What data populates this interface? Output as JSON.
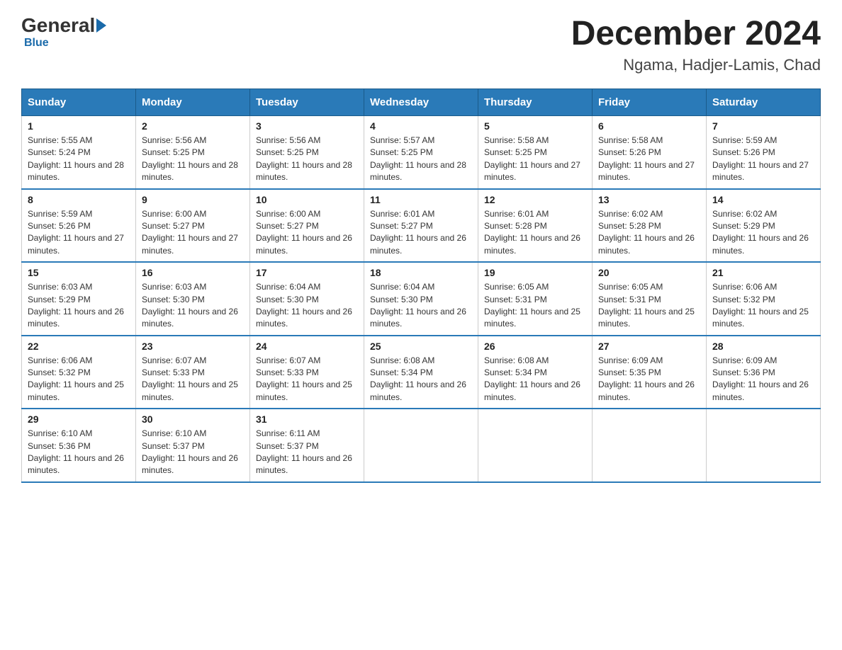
{
  "logo": {
    "general": "General",
    "blue": "Blue"
  },
  "title": "December 2024",
  "subtitle": "Ngama, Hadjer-Lamis, Chad",
  "days_of_week": [
    "Sunday",
    "Monday",
    "Tuesday",
    "Wednesday",
    "Thursday",
    "Friday",
    "Saturday"
  ],
  "weeks": [
    [
      {
        "day": "1",
        "sunrise": "5:55 AM",
        "sunset": "5:24 PM",
        "daylight": "11 hours and 28 minutes."
      },
      {
        "day": "2",
        "sunrise": "5:56 AM",
        "sunset": "5:25 PM",
        "daylight": "11 hours and 28 minutes."
      },
      {
        "day": "3",
        "sunrise": "5:56 AM",
        "sunset": "5:25 PM",
        "daylight": "11 hours and 28 minutes."
      },
      {
        "day": "4",
        "sunrise": "5:57 AM",
        "sunset": "5:25 PM",
        "daylight": "11 hours and 28 minutes."
      },
      {
        "day": "5",
        "sunrise": "5:58 AM",
        "sunset": "5:25 PM",
        "daylight": "11 hours and 27 minutes."
      },
      {
        "day": "6",
        "sunrise": "5:58 AM",
        "sunset": "5:26 PM",
        "daylight": "11 hours and 27 minutes."
      },
      {
        "day": "7",
        "sunrise": "5:59 AM",
        "sunset": "5:26 PM",
        "daylight": "11 hours and 27 minutes."
      }
    ],
    [
      {
        "day": "8",
        "sunrise": "5:59 AM",
        "sunset": "5:26 PM",
        "daylight": "11 hours and 27 minutes."
      },
      {
        "day": "9",
        "sunrise": "6:00 AM",
        "sunset": "5:27 PM",
        "daylight": "11 hours and 27 minutes."
      },
      {
        "day": "10",
        "sunrise": "6:00 AM",
        "sunset": "5:27 PM",
        "daylight": "11 hours and 26 minutes."
      },
      {
        "day": "11",
        "sunrise": "6:01 AM",
        "sunset": "5:27 PM",
        "daylight": "11 hours and 26 minutes."
      },
      {
        "day": "12",
        "sunrise": "6:01 AM",
        "sunset": "5:28 PM",
        "daylight": "11 hours and 26 minutes."
      },
      {
        "day": "13",
        "sunrise": "6:02 AM",
        "sunset": "5:28 PM",
        "daylight": "11 hours and 26 minutes."
      },
      {
        "day": "14",
        "sunrise": "6:02 AM",
        "sunset": "5:29 PM",
        "daylight": "11 hours and 26 minutes."
      }
    ],
    [
      {
        "day": "15",
        "sunrise": "6:03 AM",
        "sunset": "5:29 PM",
        "daylight": "11 hours and 26 minutes."
      },
      {
        "day": "16",
        "sunrise": "6:03 AM",
        "sunset": "5:30 PM",
        "daylight": "11 hours and 26 minutes."
      },
      {
        "day": "17",
        "sunrise": "6:04 AM",
        "sunset": "5:30 PM",
        "daylight": "11 hours and 26 minutes."
      },
      {
        "day": "18",
        "sunrise": "6:04 AM",
        "sunset": "5:30 PM",
        "daylight": "11 hours and 26 minutes."
      },
      {
        "day": "19",
        "sunrise": "6:05 AM",
        "sunset": "5:31 PM",
        "daylight": "11 hours and 25 minutes."
      },
      {
        "day": "20",
        "sunrise": "6:05 AM",
        "sunset": "5:31 PM",
        "daylight": "11 hours and 25 minutes."
      },
      {
        "day": "21",
        "sunrise": "6:06 AM",
        "sunset": "5:32 PM",
        "daylight": "11 hours and 25 minutes."
      }
    ],
    [
      {
        "day": "22",
        "sunrise": "6:06 AM",
        "sunset": "5:32 PM",
        "daylight": "11 hours and 25 minutes."
      },
      {
        "day": "23",
        "sunrise": "6:07 AM",
        "sunset": "5:33 PM",
        "daylight": "11 hours and 25 minutes."
      },
      {
        "day": "24",
        "sunrise": "6:07 AM",
        "sunset": "5:33 PM",
        "daylight": "11 hours and 25 minutes."
      },
      {
        "day": "25",
        "sunrise": "6:08 AM",
        "sunset": "5:34 PM",
        "daylight": "11 hours and 26 minutes."
      },
      {
        "day": "26",
        "sunrise": "6:08 AM",
        "sunset": "5:34 PM",
        "daylight": "11 hours and 26 minutes."
      },
      {
        "day": "27",
        "sunrise": "6:09 AM",
        "sunset": "5:35 PM",
        "daylight": "11 hours and 26 minutes."
      },
      {
        "day": "28",
        "sunrise": "6:09 AM",
        "sunset": "5:36 PM",
        "daylight": "11 hours and 26 minutes."
      }
    ],
    [
      {
        "day": "29",
        "sunrise": "6:10 AM",
        "sunset": "5:36 PM",
        "daylight": "11 hours and 26 minutes."
      },
      {
        "day": "30",
        "sunrise": "6:10 AM",
        "sunset": "5:37 PM",
        "daylight": "11 hours and 26 minutes."
      },
      {
        "day": "31",
        "sunrise": "6:11 AM",
        "sunset": "5:37 PM",
        "daylight": "11 hours and 26 minutes."
      },
      null,
      null,
      null,
      null
    ]
  ]
}
